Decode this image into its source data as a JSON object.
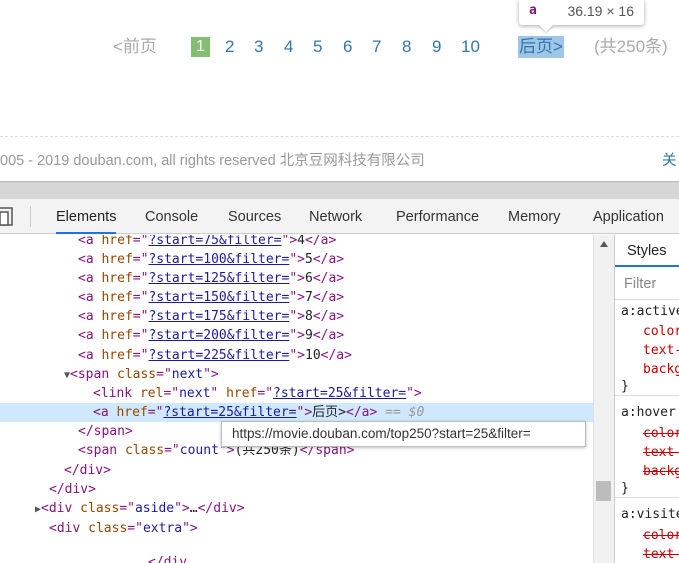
{
  "page": {
    "pager": {
      "prev": "<前页",
      "current": "1",
      "pages": [
        "2",
        "3",
        "4",
        "5",
        "6",
        "7",
        "8",
        "9",
        "10"
      ],
      "next": "后页>",
      "count": "(共250条)"
    },
    "copyright": "005 - 2019 douban.com, all rights reserved 北京豆网科技有限公司",
    "footer_link": "关"
  },
  "inspect_tooltip": {
    "tag": "a",
    "size": "36.19 × 16"
  },
  "devtools": {
    "tabs": [
      "Elements",
      "Console",
      "Sources",
      "Network",
      "Performance",
      "Memory",
      "Application"
    ],
    "active_tab": "Elements",
    "dom_lines": {
      "l1_href": "?start=75&filter=",
      "l1_text": "4",
      "l2_href": "?start=100&filter=",
      "l2_text": "5",
      "l3_href": "?start=125&filter=",
      "l3_text": "6",
      "l4_href": "?start=150&filter=",
      "l4_text": "7",
      "l5_href": "?start=175&filter=",
      "l5_text": "8",
      "l6_href": "?start=200&filter=",
      "l6_text": "9",
      "l7_href": "?start=225&filter=",
      "l7_text": "10",
      "span_class": "next",
      "link_rel": "next",
      "link_href": "?start=25&filter=",
      "sel_href": "?start=25&filter=",
      "sel_text": "后页>",
      "sel_marker": "== $0",
      "count_class": "count",
      "count_text": "(共250条)",
      "aside_class": "aside",
      "extra_class": "extra",
      "partial": "</div"
    },
    "url_tooltip": "https://movie.douban.com/top250?start=25&filter=",
    "styles": {
      "tab": "Styles",
      "filter_placeholder": "Filter",
      "rules": [
        {
          "selector": "a:active",
          "props": [
            "color",
            "text-",
            "backg"
          ]
        },
        {
          "selector": "a:hover",
          "props": [
            "color",
            "text-",
            "backg"
          ]
        },
        {
          "selector": "a:visite",
          "props": [
            "color",
            "text-"
          ]
        }
      ],
      "close": "}"
    }
  }
}
